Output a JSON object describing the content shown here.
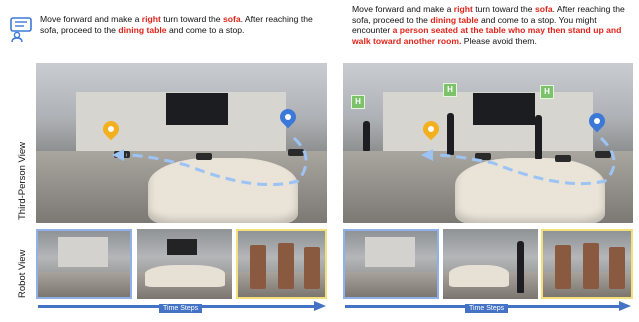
{
  "left": {
    "instruction": {
      "p1": "Move forward and make a ",
      "h1": "right",
      "p2": " turn toward the ",
      "h2": "sofa",
      "p3": ". After reaching the sofa, proceed to the ",
      "h3": "dining table",
      "p4": " and come to a stop."
    }
  },
  "right": {
    "instruction": {
      "p1": "Move forward and make a ",
      "h1": "right",
      "p2": " turn toward the ",
      "h2": "sofa",
      "p3": ". After reaching the sofa, proceed to the ",
      "h3": "dining table",
      "p4": " and come to a stop. You might encounter ",
      "h4": "a person seated at the table who may then stand up and walk toward another room.",
      "p5": " Please avoid them."
    },
    "human_badges": [
      "H",
      "H",
      "H"
    ]
  },
  "labels": {
    "third_person": "Third-Person View",
    "robot": "Robot View",
    "time_steps": "Time Steps"
  },
  "colors": {
    "highlight": "#e2231a",
    "time_arrow": "#4472c4",
    "frame_blue": "#8fb0e8",
    "frame_yellow": "#f4e07a",
    "start_pin": "#3b78d8",
    "goal_pin": "#f2b01e",
    "human_badge": "#7cc26b"
  },
  "icons": [
    "chat-person-icon",
    "start-pin-icon",
    "goal-pin-icon",
    "human-marker-icon"
  ]
}
